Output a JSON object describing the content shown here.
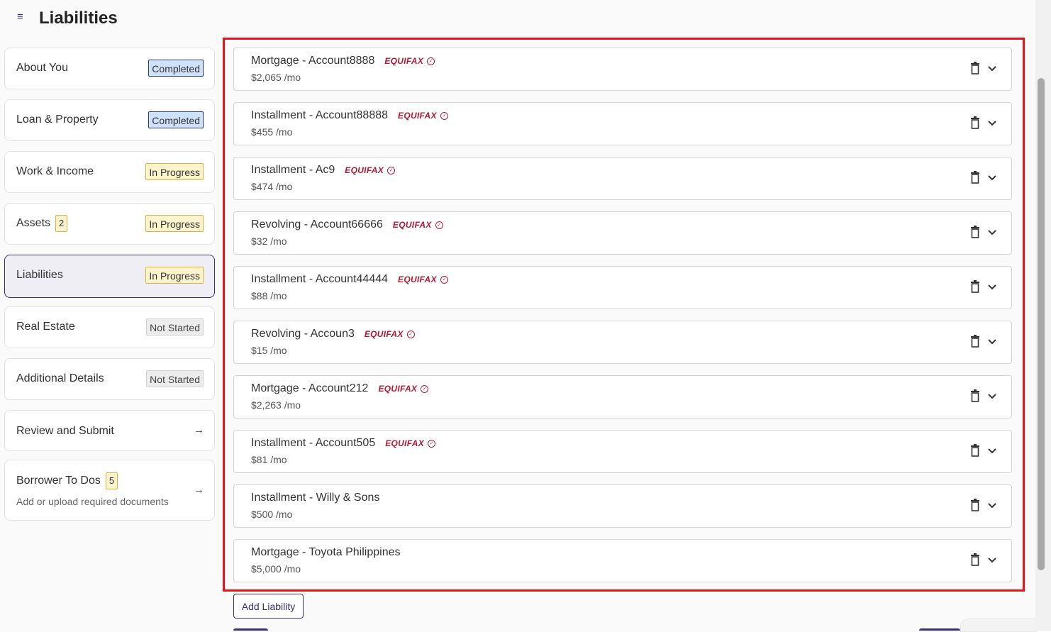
{
  "page": {
    "title": "Liabilities",
    "menu_icon": "hamburger-menu-icon"
  },
  "sidebar": {
    "items": [
      {
        "label": "About You",
        "status": "Completed",
        "status_type": "completed"
      },
      {
        "label": "Loan & Property",
        "status": "Completed",
        "status_type": "completed"
      },
      {
        "label": "Work & Income",
        "status": "In Progress",
        "status_type": "progress"
      },
      {
        "label": "Assets",
        "count": "2",
        "status": "In Progress",
        "status_type": "progress"
      },
      {
        "label": "Liabilities",
        "status": "In Progress",
        "status_type": "progress",
        "active": true
      },
      {
        "label": "Real Estate",
        "status": "Not Started",
        "status_type": "not"
      },
      {
        "label": "Additional Details",
        "status": "Not Started",
        "status_type": "not"
      }
    ],
    "review": {
      "label": "Review and Submit",
      "icon": "arrow-right-icon"
    },
    "todos": {
      "label": "Borrower To Dos",
      "count": "5",
      "subtitle": "Add or upload required documents",
      "icon": "arrow-right-icon"
    }
  },
  "liabilities": [
    {
      "title": "Mortgage - Account8888",
      "amount": "$2,065 /mo",
      "source": "EQUIFAX"
    },
    {
      "title": "Installment - Account88888",
      "amount": "$455 /mo",
      "source": "EQUIFAX"
    },
    {
      "title": "Installment - Ac9",
      "amount": "$474 /mo",
      "source": "EQUIFAX"
    },
    {
      "title": "Revolving - Account66666",
      "amount": "$32 /mo",
      "source": "EQUIFAX"
    },
    {
      "title": "Installment - Account44444",
      "amount": "$88 /mo",
      "source": "EQUIFAX"
    },
    {
      "title": "Revolving - Accoun3",
      "amount": "$15 /mo",
      "source": "EQUIFAX"
    },
    {
      "title": "Mortgage - Account212",
      "amount": "$2,263 /mo",
      "source": "EQUIFAX"
    },
    {
      "title": "Installment - Account505",
      "amount": "$81 /mo",
      "source": "EQUIFAX"
    },
    {
      "title": "Installment - Willy & Sons",
      "amount": "$500 /mo",
      "source": null
    },
    {
      "title": "Mortgage - Toyota Philippines",
      "amount": "$5,000 /mo",
      "source": null
    }
  ],
  "actions": {
    "add_liability": "Add Liability"
  },
  "colors": {
    "accent": "#3b2f7a",
    "highlight": "#e8121a",
    "equifax": "#b31b34"
  }
}
